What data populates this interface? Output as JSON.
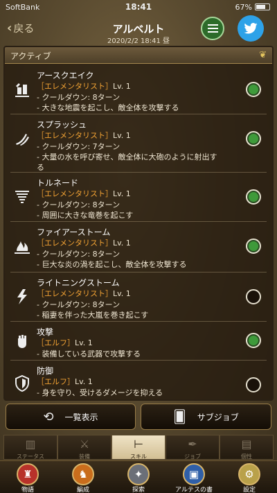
{
  "status": {
    "carrier": "SoftBank",
    "time": "18:41",
    "battery": "67%"
  },
  "header": {
    "back": "戻る",
    "title": "アルベルト",
    "date": "2020/2/2 18:41 昼"
  },
  "panel": {
    "title": "アクティブ"
  },
  "skills": [
    {
      "name": "アースクエイク",
      "cls": "［エレメンタリスト］",
      "lv": "Lv. 1",
      "lines": [
        "- クールダウン: 8ターン",
        "- 大きな地震を起こし、敵全体を攻撃する"
      ],
      "enabled": true,
      "icon": "earthquake-icon"
    },
    {
      "name": "スプラッシュ",
      "cls": "［エレメンタリスト］",
      "lv": "Lv. 1",
      "lines": [
        "- クールダウン: 7ターン",
        "- 大量の水を呼び寄せ、敵全体に大砲のように射出す",
        "る"
      ],
      "enabled": true,
      "icon": "splash-icon"
    },
    {
      "name": "トルネード",
      "cls": "［エレメンタリスト］",
      "lv": "Lv. 1",
      "lines": [
        "- クールダウン: 8ターン",
        "- 周囲に大きな竜巻を起こす"
      ],
      "enabled": true,
      "icon": "tornado-icon"
    },
    {
      "name": "ファイアーストーム",
      "cls": "［エレメンタリスト］",
      "lv": "Lv. 1",
      "lines": [
        "- クールダウン: 8ターン",
        "- 巨大な炎の渦を起こし、敵全体を攻撃する"
      ],
      "enabled": true,
      "icon": "firestorm-icon"
    },
    {
      "name": "ライトニングストーム",
      "cls": "［エレメンタリスト］",
      "lv": "Lv. 1",
      "lines": [
        "- クールダウン: 8ターン",
        "- 稲妻を伴った大嵐を巻き起こす"
      ],
      "enabled": false,
      "icon": "lightning-icon"
    },
    {
      "name": "攻撃",
      "cls": "［エルフ］",
      "lv": "Lv. 1",
      "lines": [
        "- 装備している武器で攻撃する"
      ],
      "enabled": true,
      "icon": "fist-icon"
    },
    {
      "name": "防御",
      "cls": "［エルフ］",
      "lv": "Lv. 1",
      "lines": [
        "- 身を守り、受けるダメージを抑える"
      ],
      "enabled": false,
      "icon": "shield-icon"
    }
  ],
  "buttons": {
    "list": "一覧表示",
    "subjob": "サブジョブ"
  },
  "tabs": [
    {
      "label": "ステータス",
      "icon": "stats-icon",
      "active": false
    },
    {
      "label": "装備",
      "icon": "sword-icon",
      "active": false
    },
    {
      "label": "スキル",
      "icon": "skill-tree-icon",
      "active": true
    },
    {
      "label": "ジョブ",
      "icon": "quill-icon",
      "active": false
    },
    {
      "label": "個性",
      "icon": "document-icon",
      "active": false
    }
  ],
  "nav": [
    {
      "label": "物語",
      "icon": "story-icon",
      "color": "#b8322a"
    },
    {
      "label": "編成",
      "icon": "formation-icon",
      "color": "#c96d1c"
    },
    {
      "label": "探索",
      "icon": "explore-icon",
      "color": "#6b6f78"
    },
    {
      "label": "アルテスの書",
      "icon": "book-icon",
      "color": "#2f5fa8"
    },
    {
      "label": "設定",
      "icon": "settings-icon",
      "color": "#b9a14a"
    }
  ]
}
